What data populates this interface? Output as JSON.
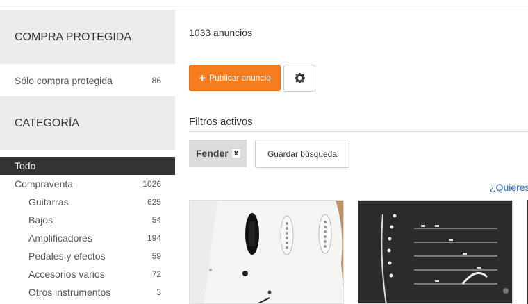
{
  "sidebar": {
    "protected_header": "COMPRA PROTEGIDA",
    "protected_row": {
      "label": "Sólo compra protegida",
      "count": "86"
    },
    "category_header": "CATEGORÍA",
    "categories": [
      {
        "label": "Todo",
        "count": ""
      },
      {
        "label": "Compraventa",
        "count": "1026"
      },
      {
        "label": "Guitarras",
        "count": "625"
      },
      {
        "label": "Bajos",
        "count": "54"
      },
      {
        "label": "Amplificadores",
        "count": "194"
      },
      {
        "label": "Pedales y efectos",
        "count": "59"
      },
      {
        "label": "Accesorios varios",
        "count": "72"
      },
      {
        "label": "Otros instrumentos",
        "count": "3"
      }
    ]
  },
  "main": {
    "result_count": "1033 anuncios",
    "publish_label": "Publicar anuncio",
    "filters_title": "Filtros activos",
    "active_filter": {
      "label": "Fender",
      "remove": "x"
    },
    "save_search_label": "Guardar búsqueda",
    "question_link": "¿Quieres"
  },
  "colors": {
    "accent": "#f47d20",
    "link": "#2a6fb5",
    "sidebar_header_bg": "#ebebeb",
    "active_row_bg": "#333333"
  },
  "icons": {
    "publish": "plus-icon",
    "settings": "gear-icon"
  }
}
